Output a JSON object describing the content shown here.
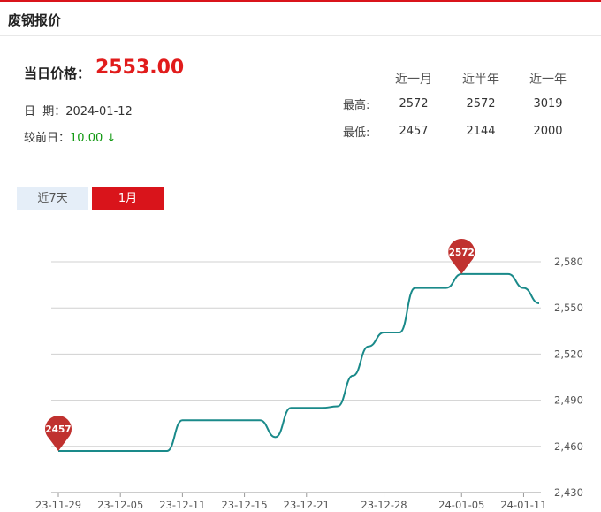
{
  "header": {
    "title": "废钢报价"
  },
  "summary": {
    "price_label": "当日价格：",
    "price_value": "2553.00",
    "date_label": "日  期：",
    "date_value": "2024-01-12",
    "change_label": "较前日：",
    "change_value": "10.00",
    "change_arrow": "↓"
  },
  "stats": {
    "columns": [
      "近一月",
      "近半年",
      "近一年"
    ],
    "rows": [
      {
        "label": "最高:",
        "values": [
          "2572",
          "2572",
          "3019"
        ]
      },
      {
        "label": "最低:",
        "values": [
          "2457",
          "2144",
          "2000"
        ]
      }
    ]
  },
  "tabs": [
    {
      "label": "近7天",
      "active": false
    },
    {
      "label": "1月",
      "active": true
    }
  ],
  "colors": {
    "accent": "#d9141b",
    "line": "#1a8a8a",
    "pin": "#c0312f",
    "down": "#119911"
  },
  "chart_data": {
    "type": "line",
    "x_ticks": [
      "23-11-29",
      "23-12-05",
      "23-12-11",
      "23-12-15",
      "23-12-21",
      "23-12-28",
      "24-01-05",
      "24-01-11"
    ],
    "y_ticks": [
      "2,430",
      "2,460",
      "2,490",
      "2,520",
      "2,550",
      "2,580"
    ],
    "ylim": [
      2430,
      2580
    ],
    "x": [
      "11-29",
      "11-30",
      "12-01",
      "12-04",
      "12-05",
      "12-06",
      "12-07",
      "12-08",
      "12-11",
      "12-12",
      "12-13",
      "12-14",
      "12-15",
      "12-18",
      "12-19",
      "12-20",
      "12-21",
      "12-22",
      "12-25",
      "12-26",
      "12-27",
      "12-28",
      "12-29",
      "01-02",
      "01-03",
      "01-04",
      "01-05",
      "01-08",
      "01-09",
      "01-10",
      "01-11",
      "01-12"
    ],
    "values": [
      2457,
      2457,
      2457,
      2457,
      2457,
      2457,
      2457,
      2457,
      2477,
      2477,
      2477,
      2477,
      2477,
      2477,
      2466,
      2485,
      2485,
      2485,
      2486,
      2506,
      2525,
      2534,
      2534,
      2563,
      2563,
      2563,
      2572,
      2572,
      2572,
      2572,
      2563,
      2553
    ],
    "annotations": [
      {
        "label": "2457",
        "type": "min",
        "index": 0
      },
      {
        "label": "2572",
        "type": "max",
        "index": 26
      }
    ]
  }
}
